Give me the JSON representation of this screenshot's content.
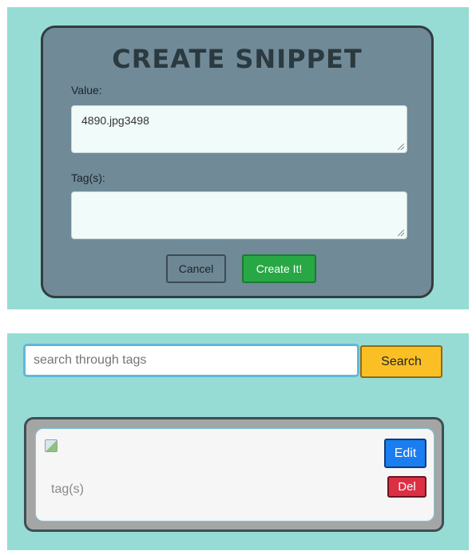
{
  "create_form": {
    "title": "CREATE SNIPPET",
    "value_label": "Value:",
    "value_text": "4890.jpg3498",
    "tags_label": "Tag(s):",
    "tags_text": "",
    "cancel_label": "Cancel",
    "create_label": "Create It!"
  },
  "search": {
    "placeholder": "search through tags",
    "button_label": "Search"
  },
  "snippet_card": {
    "tags_text": "tag(s)",
    "edit_label": "Edit",
    "delete_label": "Del"
  },
  "colors": {
    "panel_background": "#96dcd5",
    "modal_background": "#708a98",
    "create_button": "#28a745",
    "search_button": "#fbbf26",
    "edit_button": "#1a7df0",
    "delete_button": "#dc2f44"
  }
}
